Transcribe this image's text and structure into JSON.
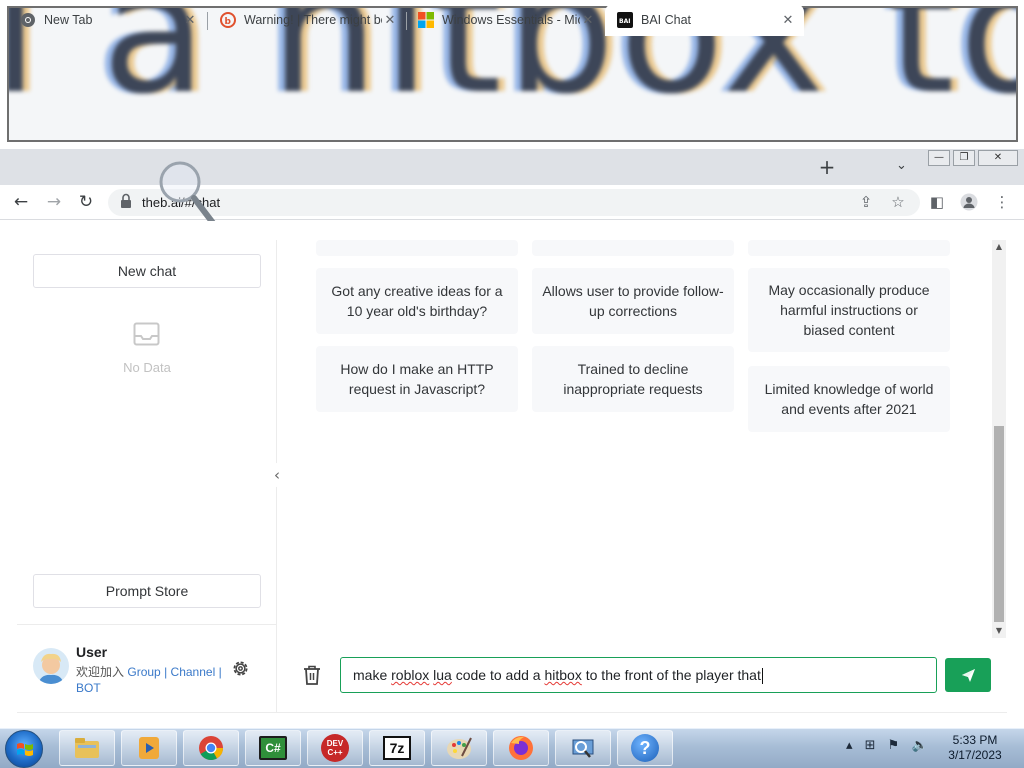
{
  "magnifier": {
    "text": "l a hitbox to"
  },
  "browser": {
    "tabs": [
      {
        "title": "New Tab",
        "active": false
      },
      {
        "title": "Warning! | There might be",
        "active": false
      },
      {
        "title": "Windows Essentials - Mic",
        "active": false
      },
      {
        "title": "BAI Chat",
        "active": true
      }
    ],
    "new_tab_label": "+",
    "url": "theb.ai/#/chat"
  },
  "sidebar": {
    "new_chat_label": "New chat",
    "empty_label": "No Data",
    "prompt_store_label": "Prompt Store",
    "user": {
      "name": "User",
      "join_text": "欢迎加入",
      "group_link": "Group",
      "channel_link": "Channel",
      "bot_link": "BOT",
      "separator": "|"
    }
  },
  "cards": {
    "col1": [
      "Got any creative ideas for a 10 year old's birthday?",
      "How do I make an HTTP request in Javascript?"
    ],
    "col2": [
      "Allows user to provide follow-up corrections",
      "Trained to decline inappropriate requests"
    ],
    "col3": [
      "May occasionally produce harmful instructions or biased content",
      "Limited knowledge of world and events after 2021"
    ]
  },
  "composer": {
    "text_before": "make ",
    "word_roblox": "roblox",
    "space1": " ",
    "word_lua": "lua",
    "text_middle": " code to add a ",
    "word_hitbox": "hitbox",
    "text_after": " to the front of the player that"
  },
  "taskbar": {
    "apps": [
      "file-explorer",
      "media-player",
      "chrome",
      "csharp-editor",
      "dev-cpp",
      "7zip",
      "paint",
      "firefox",
      "network-tool",
      "help"
    ],
    "devcpp_label": "DEV C++",
    "sevenzip_label": "7z",
    "csharp_label": "C#",
    "help_label": "?",
    "time": "5:33 PM",
    "date": "3/17/2023"
  },
  "colors": {
    "accent": "#18a058",
    "link": "#3a79c9",
    "card_bg": "#f7f8fa"
  }
}
